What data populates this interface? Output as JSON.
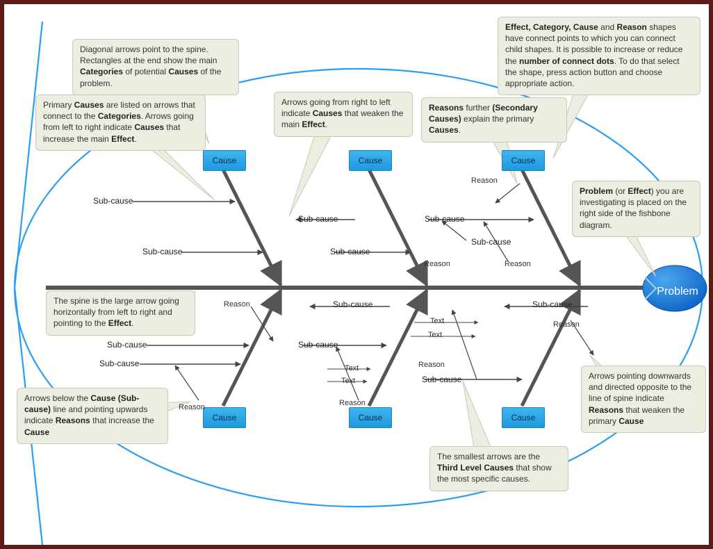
{
  "problem": {
    "label": "Problem"
  },
  "causes": {
    "top1": "Cause",
    "top2": "Cause",
    "top3": "Cause",
    "bot1": "Cause",
    "bot2": "Cause",
    "bot3": "Cause"
  },
  "labels": {
    "subcause": "Sub-cause",
    "reason": "Reason",
    "text": "Text"
  },
  "callouts": {
    "diagonal": "Diagonal arrows point to the spine. Rectangles at the end show the main <b>Categories</b> of potential <b>Causes</b> of the problem.",
    "primary": "Primary <b>Causes</b> are listed on arrows that connect to the <b>Categories</b>. Arrows going from left to right indicate <b>Causes</b> that increase the main <b>Effect</b>.",
    "weaken": "Arrows going from right to left indicate <b>Causes</b> that weaken the main <b>Effect</b>.",
    "secondary": "<b>Reasons</b> further <b>(Secondary Causes)</b> explain the primary <b>Causes</b>.",
    "connect": "<b>Effect, Category, Cause</b> and <b>Reason</b> shapes have connect points to which you can connect child shapes. It is possible to increase or reduce the <b>number of connect dots</b>. To do that select the shape, press action button and choose appropriate action.",
    "problemSide": "<b>Problem</b> (or <b>Effect</b>) you are investigating is placed on the right side of the fishbone diagram.",
    "spine": "The spine is the large arrow going horizontally from left to right and pointing to the <b>Effect</b>.",
    "reasonsUp": "Arrows below the <b>Cause (Sub-cause)</b> line and pointing upwards indicate <b>Reasons</b> that increase the <b>Cause</b>",
    "third": "The smallest arrows are the <b>Third Level Causes</b> that show the most specific causes.",
    "reasonsDown": "Arrows pointing downwards and directed opposite to the line of spine indicate <b>Reasons</b> that weaken the primary <b>Cause</b>"
  }
}
